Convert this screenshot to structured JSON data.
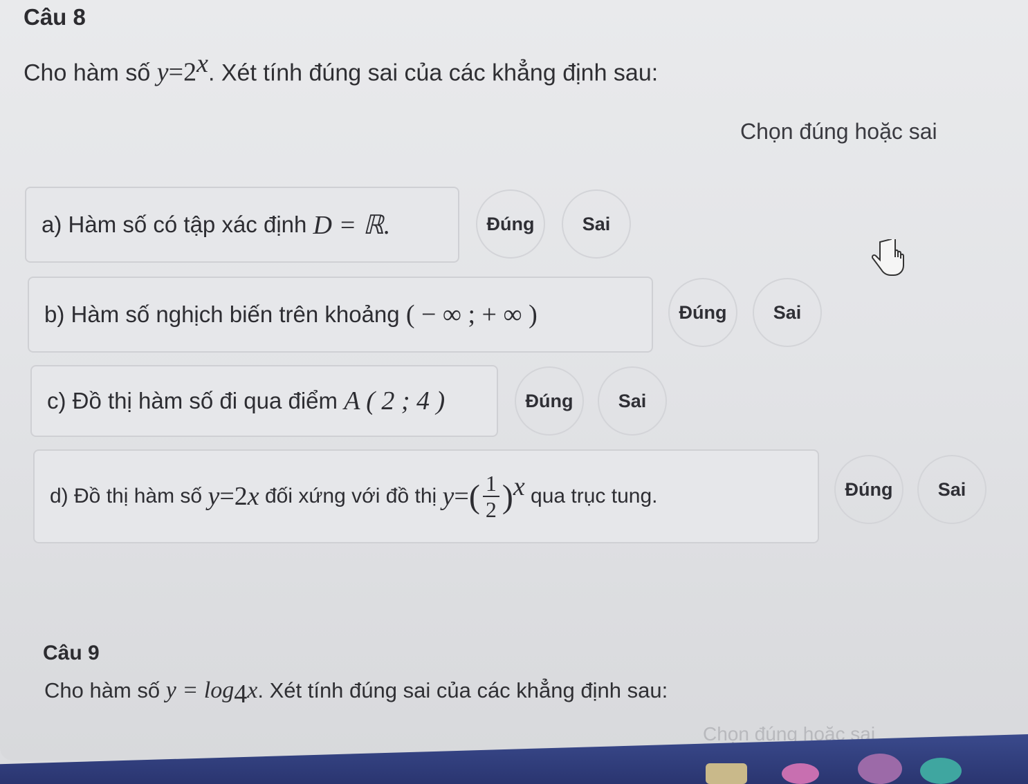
{
  "q8": {
    "title": "Câu 8",
    "stem_prefix": "Cho hàm số",
    "func_lhs": "y",
    "func_eq": "=",
    "func_base": "2",
    "func_exp": "x",
    "stem_suffix": ". Xét tính đúng sai của các khẳng định sau:",
    "choose_label": "Chọn đúng hoặc sai",
    "statements": [
      {
        "text": "a) Hàm số có tập xác định",
        "math": "D = ℝ.",
        "true_label": "Đúng",
        "false_label": "Sai"
      },
      {
        "text": "b) Hàm số nghịch biến trên khoảng",
        "math": "( − ∞ ; + ∞ )",
        "true_label": "Đúng",
        "false_label": "Sai"
      },
      {
        "text": "c) Đồ thị hàm số đi qua điểm",
        "math": "A ( 2 ; 4 )",
        "true_label": "Đúng",
        "false_label": "Sai"
      },
      {
        "text": "d) Đồ thị hàm số",
        "math_a_lhs": "y",
        "math_a_base": "2",
        "math_a_exp": "x",
        "mid_text": "đối xứng với đồ thị",
        "math_b_lhs": "y",
        "frac_num": "1",
        "frac_den": "2",
        "math_b_exp": "x",
        "end_text": "qua trục tung.",
        "true_label": "Đúng",
        "false_label": "Sai"
      }
    ]
  },
  "q9": {
    "title": "Câu 9",
    "stem_prefix": "Cho hàm số",
    "func": "y = log",
    "func_sub": "4",
    "func_var": "x",
    "stem_suffix": ". Xét tính đúng sai của các khẳng định sau:",
    "choose_label": "Chọn đúng hoặc sai"
  },
  "colors": {
    "background": "#e6e7ea",
    "taskbar": "#2f3b7a"
  }
}
